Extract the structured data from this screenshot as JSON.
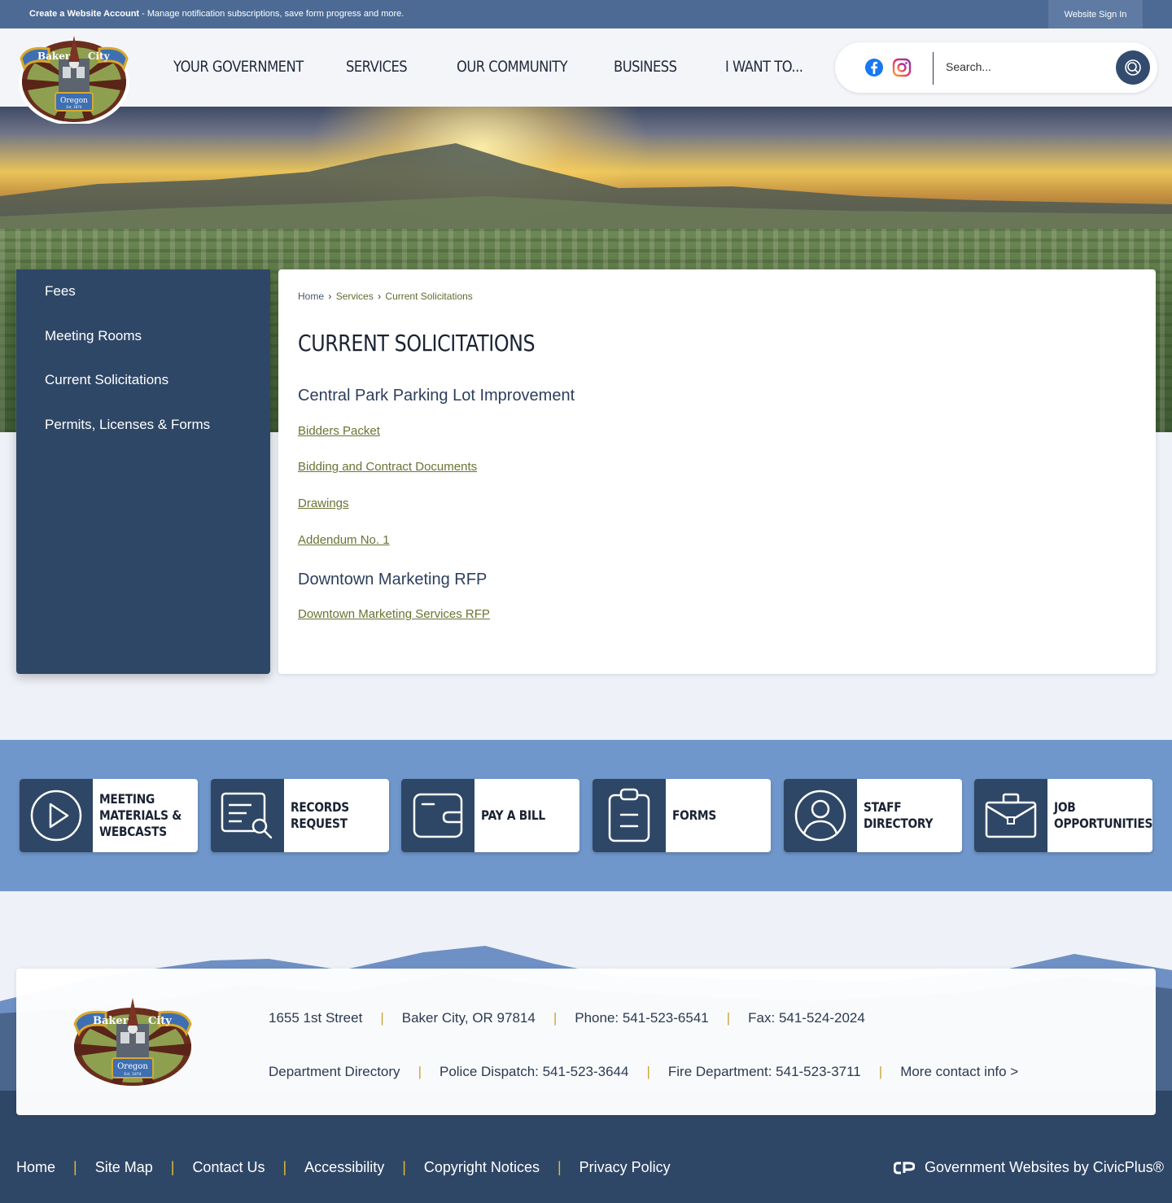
{
  "topbar": {
    "create_account": "Create a Website Account",
    "create_account_desc": " - Manage notification subscriptions, save form progress and more.",
    "sign_in": "Website Sign In"
  },
  "logo": {
    "word_left": "Baker",
    "word_right": "City",
    "banner": "Oregon",
    "est": "Est. 1874"
  },
  "nav": {
    "items": [
      "YOUR GOVERNMENT",
      "SERVICES",
      "OUR COMMUNITY",
      "BUSINESS",
      "I WANT TO..."
    ]
  },
  "search": {
    "placeholder": "Search..."
  },
  "colors": {
    "navy": "#2f4766",
    "topbar": "#4c6a93",
    "band": "#7097cb",
    "link_olive": "#6b7334",
    "footer_accent": "#c9a33a"
  },
  "sidemenu": {
    "items": [
      "Fees",
      "Meeting Rooms",
      "Current Solicitations",
      "Permits, Licenses & Forms"
    ]
  },
  "content": {
    "breadcrumb": [
      "Home",
      "Services",
      "Current Solicitations"
    ],
    "breadcrumb_sep": "›",
    "title": "CURRENT SOLICITATIONS",
    "sections": [
      {
        "title": "Central Park Parking Lot Improvement",
        "links": [
          "Bidders Packet",
          "Bidding and Contract Documents",
          "Drawings",
          "Addendum No. 1"
        ]
      },
      {
        "title": "Downtown Marketing RFP",
        "links": [
          "Downtown Marketing Services RFP"
        ]
      }
    ]
  },
  "quicklinks": [
    {
      "label": "MEETING MATERIALS & WEBCASTS",
      "icon": "play-icon"
    },
    {
      "label": "RECORDS REQUEST",
      "icon": "document-search-icon"
    },
    {
      "label": "PAY A BILL",
      "icon": "wallet-icon"
    },
    {
      "label": "FORMS",
      "icon": "clipboard-icon"
    },
    {
      "label": "STAFF DIRECTORY",
      "icon": "user-icon"
    },
    {
      "label": "JOB OPPORTUNITIES",
      "icon": "briefcase-icon"
    }
  ],
  "contact": {
    "row1": [
      "1655 1st Street",
      "Baker City, OR 97814",
      "Phone: 541-523-6541",
      "Fax: 541-524-2024"
    ],
    "row2": [
      "Department Directory",
      "Police Dispatch: 541-523-3644",
      "Fire Department: 541-523-3711",
      "More contact info >"
    ],
    "separator": "|"
  },
  "footer": {
    "links": [
      "Home",
      "Site Map",
      "Contact Us",
      "Accessibility",
      "Copyright Notices",
      "Privacy Policy"
    ],
    "separator": "|",
    "civicplus": "Government Websites by CivicPlus®"
  }
}
